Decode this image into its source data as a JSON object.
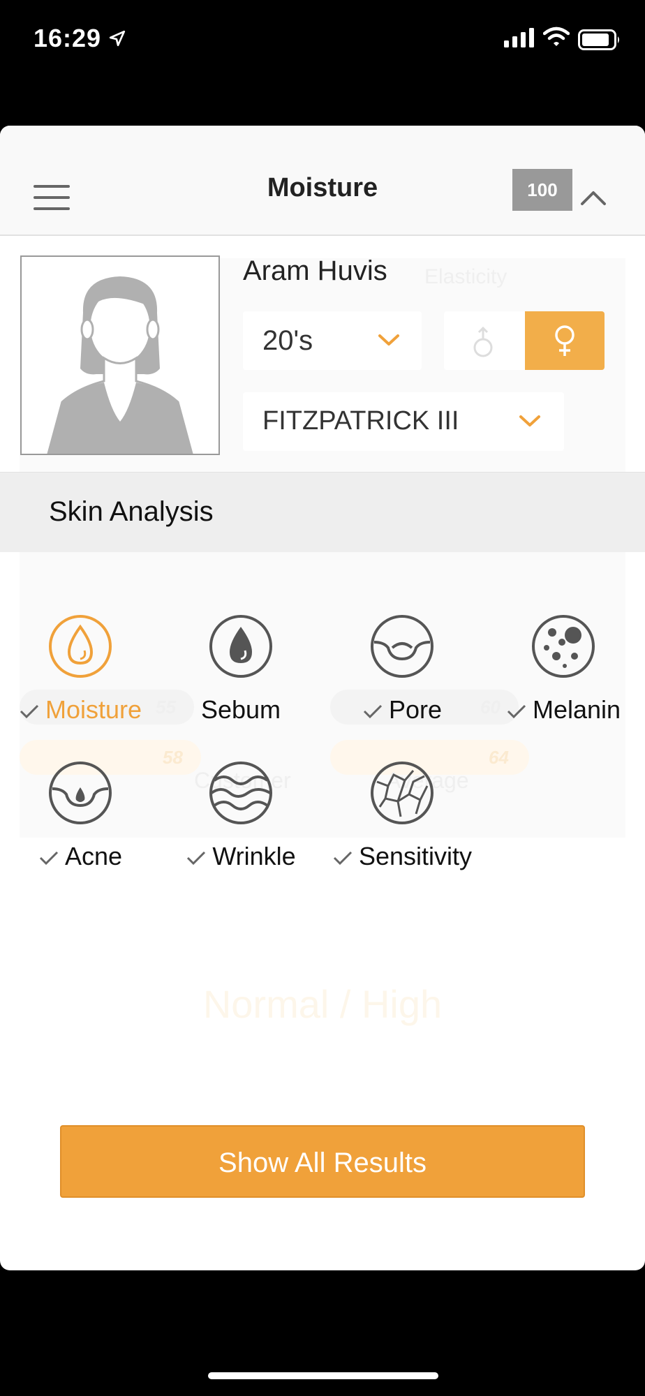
{
  "status_bar": {
    "time": "16:29"
  },
  "header": {
    "title": "Moisture",
    "score": "100"
  },
  "profile": {
    "name": "Aram Huvis",
    "age": "20's",
    "skin_type": "FITZPATRICK III",
    "gender_selected": "female"
  },
  "section": {
    "label": "Skin Analysis"
  },
  "analysis_items": [
    {
      "label": "Moisture",
      "icon": "moisture-icon",
      "checked": true,
      "active": true
    },
    {
      "label": "Sebum",
      "icon": "sebum-icon",
      "checked": false,
      "active": false
    },
    {
      "label": "Pore",
      "icon": "pore-icon",
      "checked": true,
      "active": false
    },
    {
      "label": "Melanin",
      "icon": "melanin-icon",
      "checked": true,
      "active": false
    },
    {
      "label": "Acne",
      "icon": "acne-icon",
      "checked": true,
      "active": false
    },
    {
      "label": "Wrinkle",
      "icon": "wrinkle-icon",
      "checked": true,
      "active": false
    },
    {
      "label": "Sensitivity",
      "icon": "sensitivity-icon",
      "checked": true,
      "active": false
    }
  ],
  "background_overlay": {
    "chart_label": "Elasticity",
    "bar_values": [
      "55",
      "60",
      "58",
      "64"
    ],
    "legend": [
      "Customer",
      "Average"
    ],
    "result_text": "Normal / High"
  },
  "actions": {
    "show_all_label": "Show All Results"
  },
  "colors": {
    "accent": "#f0a13a",
    "score_bg": "#999999",
    "section_bg": "#eeeeee"
  }
}
